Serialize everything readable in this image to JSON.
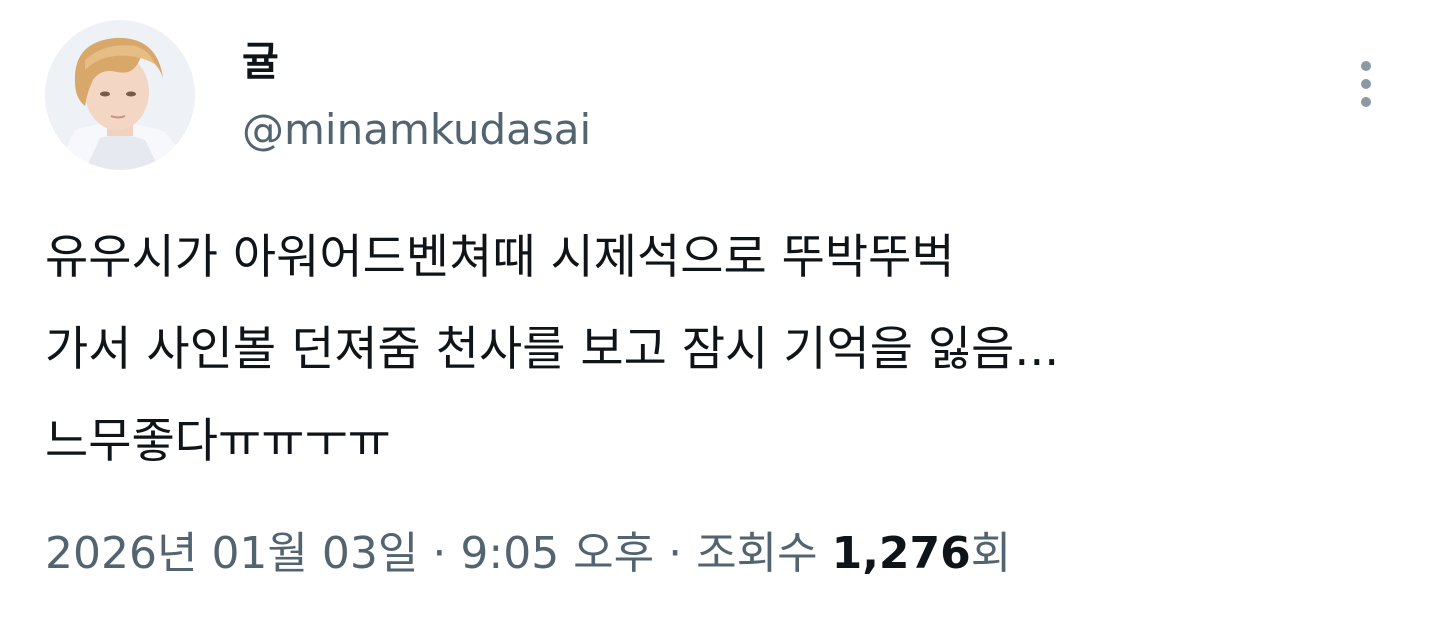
{
  "author": {
    "display_name": "귤",
    "handle": "@minamkudasai",
    "avatar_icon": "profile-photo"
  },
  "tweet": {
    "lines": [
      "유우시가 아워어드벤쳐때 시제석으로 뚜박뚜벅",
      "가서 사인볼 던져줌 천사를 보고 잠시 기억을 잃음...",
      "느무좋다ㅠㅠㅜㅠ"
    ]
  },
  "meta": {
    "date": "2026년 01월 03일",
    "separator": "·",
    "time": "9:05 오후",
    "views_label": "조회수",
    "views_count": "1,276",
    "views_suffix": "회"
  },
  "menu": {
    "icon": "more-vertical-icon"
  },
  "colors": {
    "primary_text": "#0f1419",
    "secondary_text": "#536471",
    "icon_gray": "#8b98a5"
  }
}
